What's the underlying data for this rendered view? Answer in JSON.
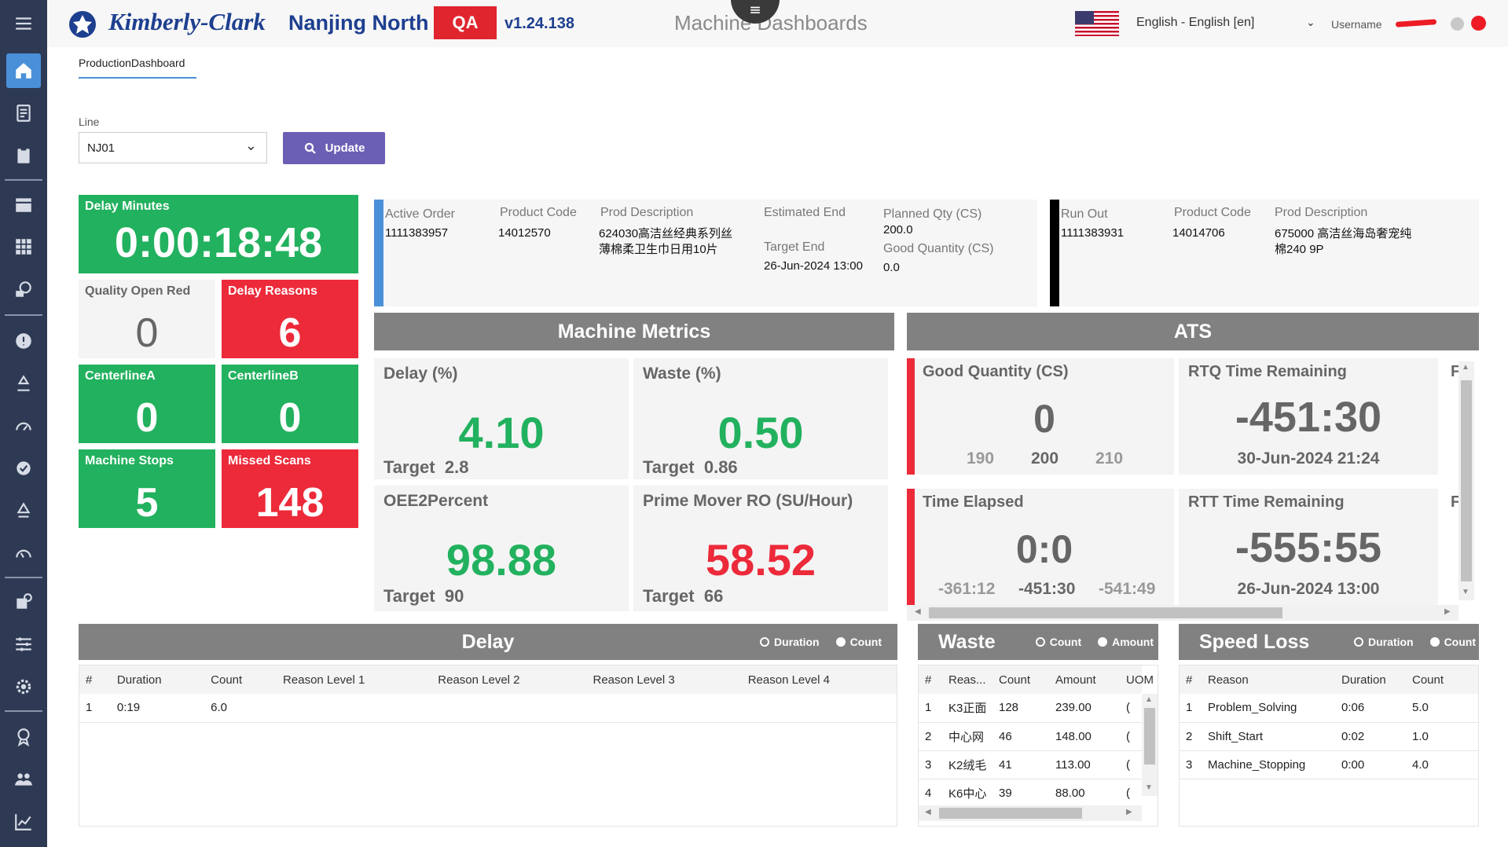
{
  "header": {
    "logo_text": "Kimberly-Clark",
    "site": "Nanjing North",
    "env_badge": "QA",
    "version": "v1.24.138",
    "title": "Machine Dashboards",
    "language": "English - English [en]",
    "username_label": "Username"
  },
  "tabs": {
    "active": "ProductionDashboard"
  },
  "filters": {
    "line_label": "Line",
    "line_value": "NJ01",
    "update_label": "Update"
  },
  "tiles": {
    "delay_minutes": {
      "title": "Delay Minutes",
      "value": "0:00:18:48"
    },
    "quality_open_red": {
      "title": "Quality Open Red",
      "value": "0"
    },
    "delay_reasons": {
      "title": "Delay Reasons",
      "value": "6"
    },
    "centerline_a": {
      "title": "CenterlineA",
      "value": "0"
    },
    "centerline_b": {
      "title": "CenterlineB",
      "value": "0"
    },
    "machine_stops": {
      "title": "Machine Stops",
      "value": "5"
    },
    "missed_scans": {
      "title": "Missed Scans",
      "value": "148"
    }
  },
  "active_order": {
    "label": "Active Order",
    "value": "1111383957",
    "product_code_label": "Product Code",
    "product_code": "14012570",
    "desc_label": "Prod Description",
    "desc_line1": "624030高洁丝经典系列丝",
    "desc_line2": "薄棉柔卫生巾日用10片",
    "est_end_label": "Estimated End",
    "target_end_label": "Target End",
    "target_end": "26-Jun-2024 13:00",
    "planned_qty_label": "Planned Qty (CS)",
    "planned_qty": "200.0",
    "good_qty_label": "Good Quantity (CS)",
    "good_qty": "0.0"
  },
  "run_out": {
    "label": "Run Out",
    "value": "1111383931",
    "product_code_label": "Product Code",
    "product_code": "14014706",
    "desc_label": "Prod Description",
    "desc_line1": "675000 高洁丝海岛奢宠纯",
    "desc_line2": "棉240 9P"
  },
  "machine_metrics": {
    "title": "Machine Metrics",
    "delay": {
      "title": "Delay (%)",
      "value": "4.10",
      "target_label": "Target",
      "target": "2.8"
    },
    "waste": {
      "title": "Waste (%)",
      "value": "0.50",
      "target_label": "Target",
      "target": "0.86"
    },
    "oee": {
      "title": "OEE2Percent",
      "value": "98.88",
      "target_label": "Target",
      "target": "90"
    },
    "prime_mover": {
      "title": "Prime Mover RO (SU/Hour)",
      "value": "58.52",
      "target_label": "Target",
      "target": "66"
    }
  },
  "ats": {
    "title": "ATS",
    "good_qty": {
      "title": "Good Quantity (CS)",
      "value": "0",
      "low": "190",
      "mid": "200",
      "high": "210"
    },
    "rtq": {
      "title": "RTQ Time Remaining",
      "value": "-451:30",
      "date": "30-Jun-2024 21:24",
      "extra": "F"
    },
    "time_elapsed": {
      "title": "Time Elapsed",
      "value": "0:0",
      "low": "-361:12",
      "mid": "-451:30",
      "high": "-541:49"
    },
    "rtt": {
      "title": "RTT Time Remaining",
      "value": "-555:55",
      "date": "26-Jun-2024 13:00",
      "extra": "F"
    }
  },
  "delay_table": {
    "title": "Delay",
    "radio_duration": "Duration",
    "radio_count": "Count",
    "columns": [
      "#",
      "Duration",
      "Count",
      "Reason Level 1",
      "Reason Level 2",
      "Reason Level 3",
      "Reason Level 4"
    ],
    "rows": [
      [
        "1",
        "0:19",
        "6.0",
        "",
        "",
        "",
        ""
      ]
    ]
  },
  "waste_table": {
    "title": "Waste",
    "radio_count": "Count",
    "radio_amount": "Amount",
    "columns": [
      "#",
      "Reas...",
      "Count",
      "Amount",
      "UOM"
    ],
    "rows": [
      [
        "1",
        "K3正面",
        "128",
        "239.00",
        "("
      ],
      [
        "2",
        "中心网",
        "46",
        "148.00",
        "("
      ],
      [
        "3",
        "K2绒毛",
        "41",
        "113.00",
        "("
      ],
      [
        "4",
        "K6中心",
        "39",
        "88.00",
        "("
      ]
    ]
  },
  "speed_loss_table": {
    "title": "Speed Loss",
    "radio_duration": "Duration",
    "radio_count": "Count",
    "columns": [
      "#",
      "Reason",
      "Duration",
      "Count"
    ],
    "rows": [
      [
        "1",
        "Problem_Solving",
        "0:06",
        "5.0"
      ],
      [
        "2",
        "Shift_Start",
        "0:02",
        "1.0"
      ],
      [
        "3",
        "Machine_Stopping",
        "0:00",
        "4.0"
      ]
    ]
  },
  "colors": {
    "green": "#22b15e",
    "red": "#ec2a3a",
    "sidebar": "#2e3a53",
    "brand": "#1d3f8f",
    "update": "#6b5fb5"
  }
}
